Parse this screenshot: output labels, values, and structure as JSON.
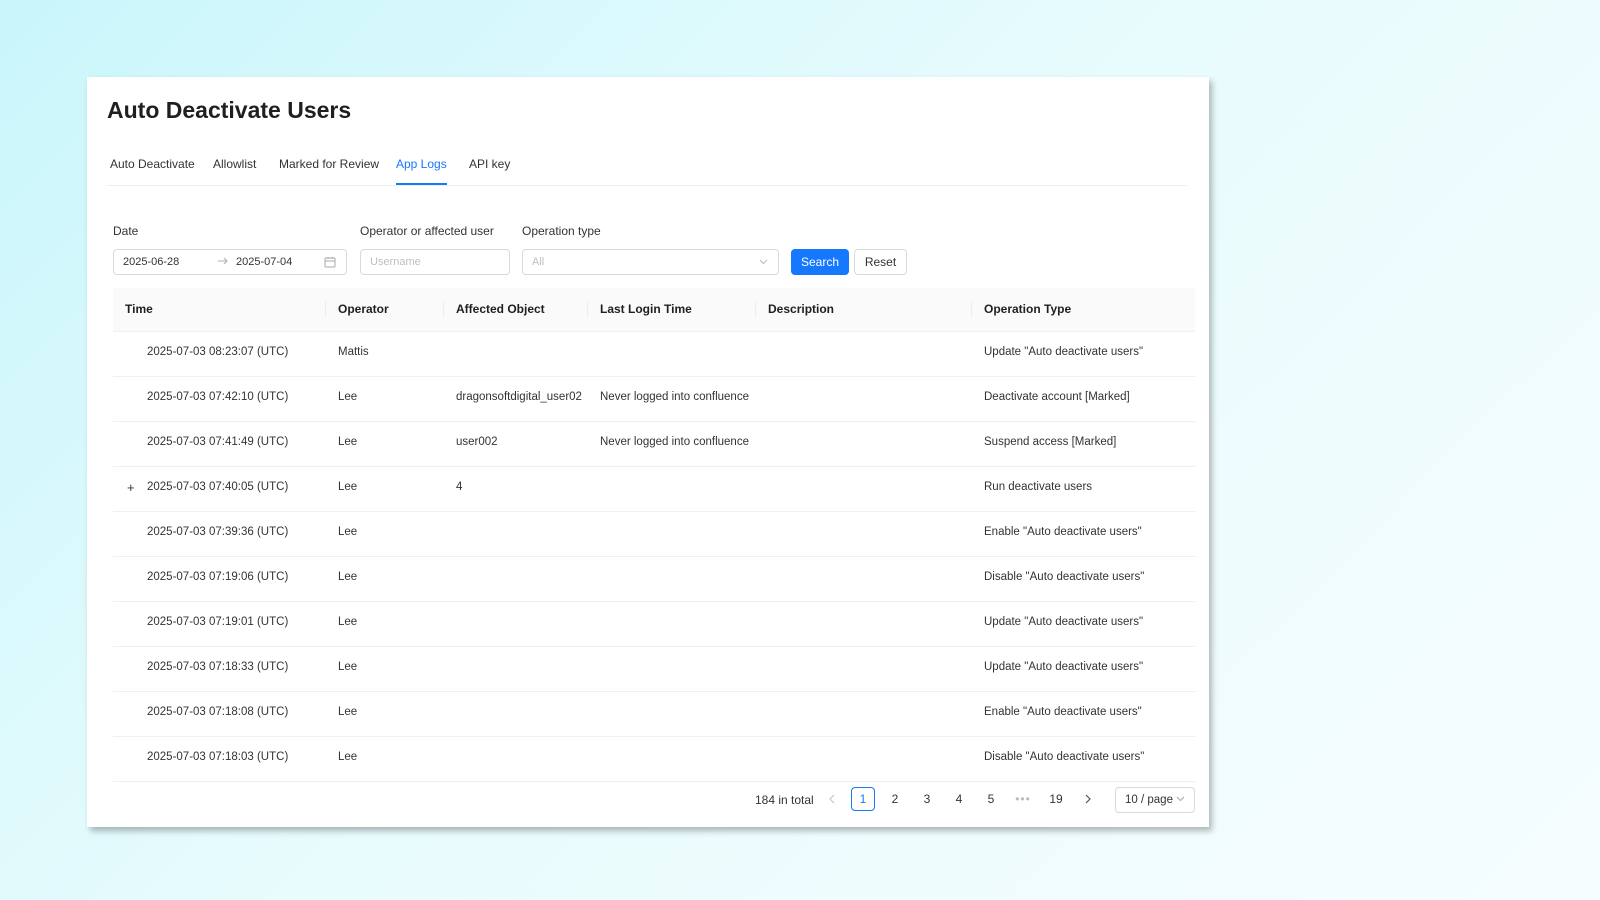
{
  "page": {
    "title": "Auto Deactivate Users"
  },
  "tabs": [
    {
      "label": "Auto Deactivate",
      "active": false
    },
    {
      "label": "Allowlist",
      "active": false
    },
    {
      "label": "Marked for Review",
      "active": false
    },
    {
      "label": "App Logs",
      "active": true
    },
    {
      "label": "API key",
      "active": false
    }
  ],
  "filters": {
    "date_label": "Date",
    "date_start": "2025-06-28",
    "date_end": "2025-07-04",
    "date_separator_icon": "arrow-right-icon",
    "date_icon": "calendar-icon",
    "user_label": "Operator or affected user",
    "user_placeholder": "Username",
    "user_value": "",
    "type_label": "Operation type",
    "type_value": "All",
    "type_icon": "chevron-down-icon",
    "search_label": "Search",
    "reset_label": "Reset"
  },
  "table": {
    "columns": [
      "Time",
      "Operator",
      "Affected Object",
      "Last Login Time",
      "Description",
      "Operation Type"
    ],
    "rows": [
      {
        "expandable": false,
        "expand_symbol": "",
        "time": "2025-07-03 08:23:07 (UTC)",
        "operator": "Mattis",
        "affected": "",
        "last_login": "",
        "description": "",
        "operation": "Update \"Auto deactivate users\""
      },
      {
        "expandable": false,
        "expand_symbol": "",
        "time": "2025-07-03 07:42:10 (UTC)",
        "operator": "Lee",
        "affected": "dragonsoftdigital_user02",
        "last_login": "Never logged into confluence",
        "description": "",
        "operation": "Deactivate account [Marked]"
      },
      {
        "expandable": false,
        "expand_symbol": "",
        "time": "2025-07-03 07:41:49 (UTC)",
        "operator": "Lee",
        "affected": "user002",
        "last_login": "Never logged into confluence",
        "description": "",
        "operation": "Suspend access [Marked]"
      },
      {
        "expandable": true,
        "expand_symbol": "+",
        "time": "2025-07-03 07:40:05 (UTC)",
        "operator": "Lee",
        "affected": "4",
        "last_login": "",
        "description": "",
        "operation": "Run deactivate users"
      },
      {
        "expandable": false,
        "expand_symbol": "",
        "time": "2025-07-03 07:39:36 (UTC)",
        "operator": "Lee",
        "affected": "",
        "last_login": "",
        "description": "",
        "operation": "Enable \"Auto deactivate users\""
      },
      {
        "expandable": false,
        "expand_symbol": "",
        "time": "2025-07-03 07:19:06 (UTC)",
        "operator": "Lee",
        "affected": "",
        "last_login": "",
        "description": "",
        "operation": "Disable \"Auto deactivate users\""
      },
      {
        "expandable": false,
        "expand_symbol": "",
        "time": "2025-07-03 07:19:01 (UTC)",
        "operator": "Lee",
        "affected": "",
        "last_login": "",
        "description": "",
        "operation": "Update \"Auto deactivate users\""
      },
      {
        "expandable": false,
        "expand_symbol": "",
        "time": "2025-07-03 07:18:33 (UTC)",
        "operator": "Lee",
        "affected": "",
        "last_login": "",
        "description": "",
        "operation": "Update \"Auto deactivate users\""
      },
      {
        "expandable": false,
        "expand_symbol": "",
        "time": "2025-07-03 07:18:08 (UTC)",
        "operator": "Lee",
        "affected": "",
        "last_login": "",
        "description": "",
        "operation": "Enable \"Auto deactivate users\""
      },
      {
        "expandable": false,
        "expand_symbol": "",
        "time": "2025-07-03 07:18:03 (UTC)",
        "operator": "Lee",
        "affected": "",
        "last_login": "",
        "description": "",
        "operation": "Disable \"Auto deactivate users\""
      }
    ]
  },
  "pagination": {
    "total_text": "184 in total",
    "prev_icon": "chevron-left-icon",
    "next_icon": "chevron-right-icon",
    "pages": [
      "1",
      "2",
      "3",
      "4",
      "5"
    ],
    "current": "1",
    "ellipsis": "•••",
    "last_page": "19",
    "page_size": "10 / page",
    "page_size_icon": "chevron-down-icon"
  },
  "colors": {
    "accent": "#1677ff",
    "background_gradient_start": "#c9f6fb",
    "panel": "#ffffff"
  }
}
